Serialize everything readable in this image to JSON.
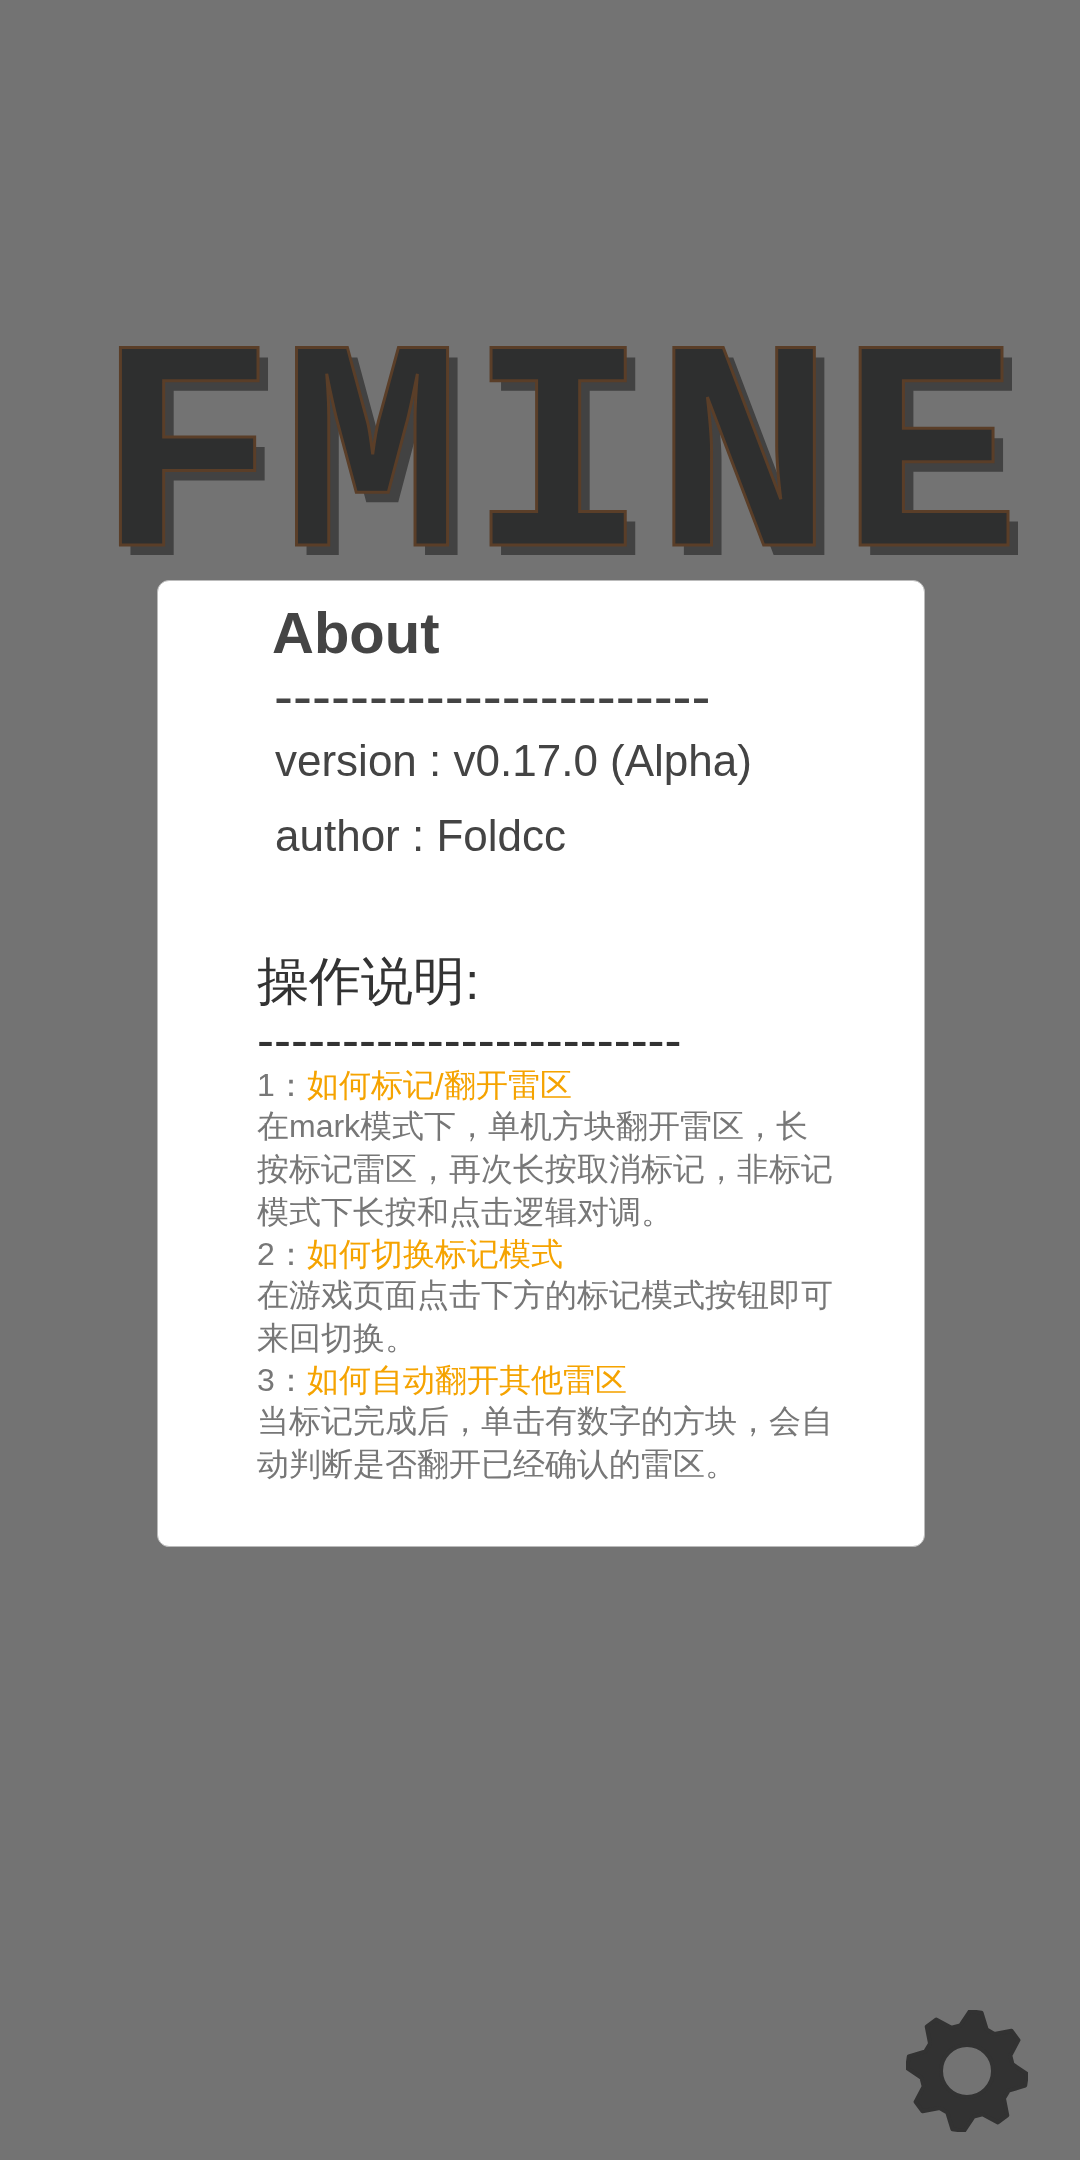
{
  "logo": "FMINE",
  "about": {
    "title": "About",
    "divider": "-----------------------",
    "version": "version : v0.17.0 (Alpha)",
    "author": "author : Foldcc"
  },
  "help": {
    "title": "操作说明:",
    "divider": "-------------------------",
    "items": [
      {
        "number": "1：",
        "title": "如何标记/翻开雷区",
        "text": "在mark模式下，单机方块翻开雷区，长按标记雷区，再次长按取消标记，非标记模式下长按和点击逻辑对调。"
      },
      {
        "number": "2：",
        "title": "如何切换标记模式",
        "text": "在游戏页面点击下方的标记模式按钮即可来回切换。"
      },
      {
        "number": "3：",
        "title": "如何自动翻开其他雷区",
        "text": "当标记完成后，单击有数字的方块，会自动判断是否翻开已经确认的雷区。"
      }
    ]
  }
}
